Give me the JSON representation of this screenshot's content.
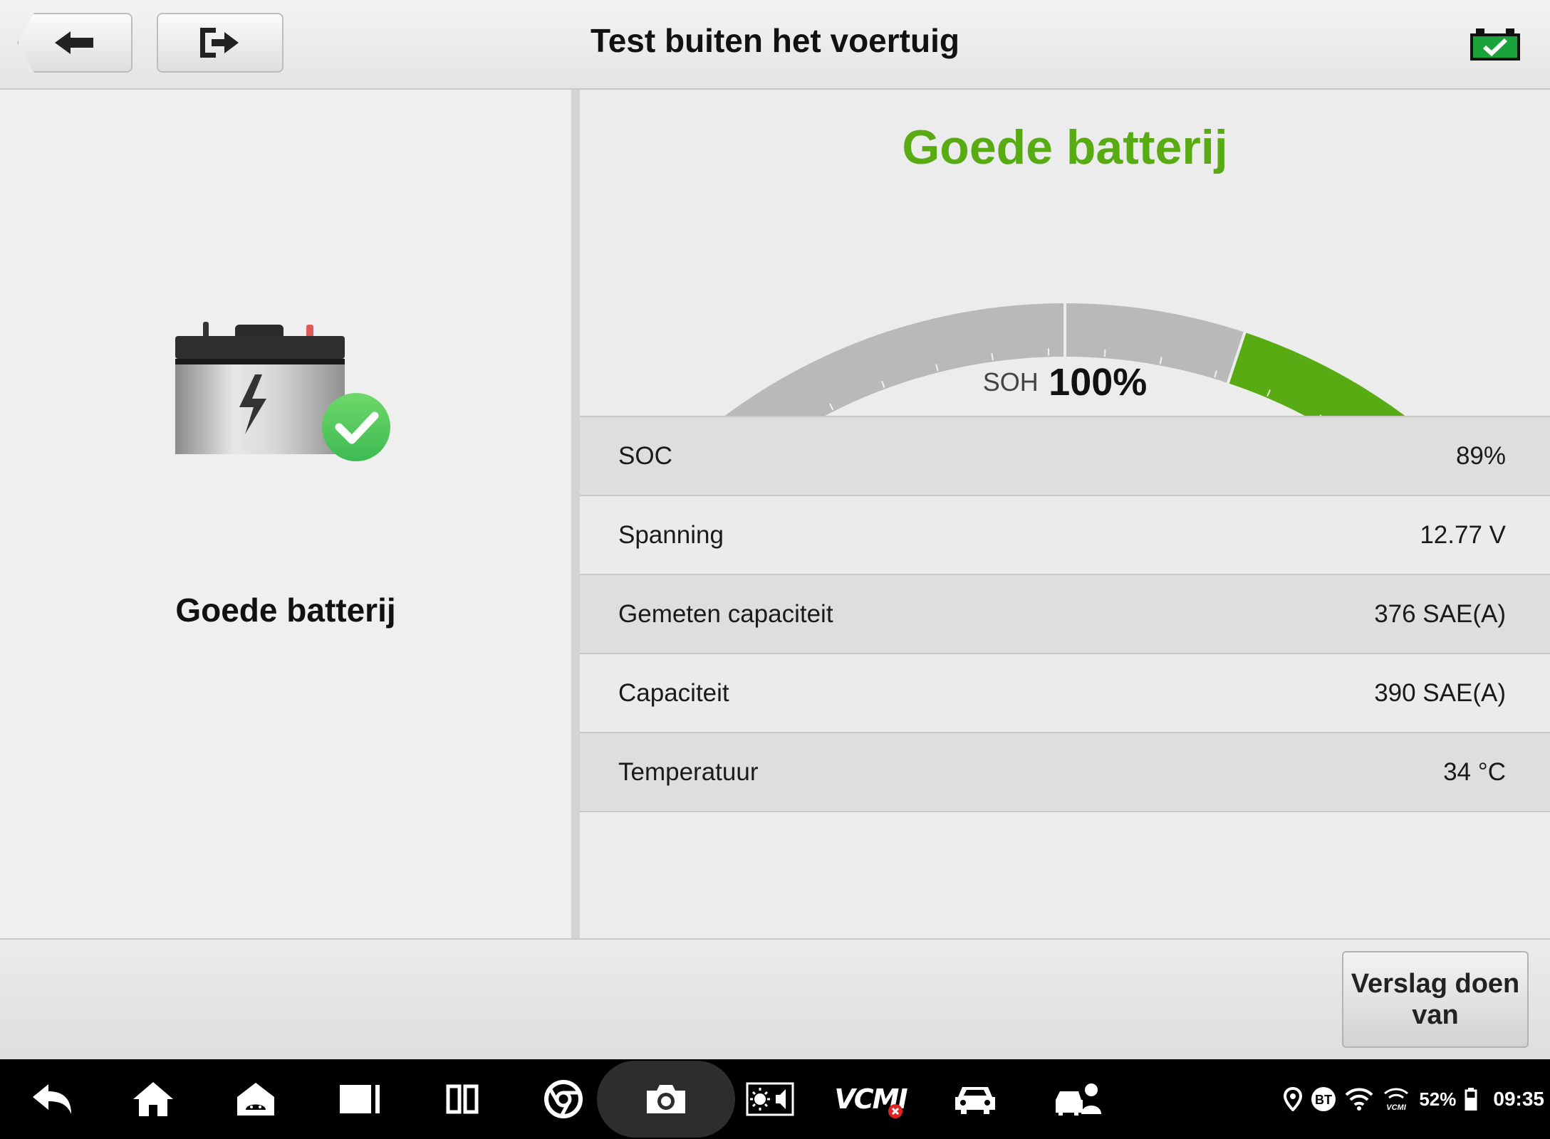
{
  "header": {
    "title": "Test buiten het voertuig",
    "back_icon": "back-arrow-icon",
    "exit_icon": "exit-icon",
    "status_icon": "battery-ok-icon"
  },
  "left_panel": {
    "icon": "battery-check-icon",
    "status_text": "Goede batterij"
  },
  "right_panel": {
    "result_title": "Goede batterij",
    "gauge": {
      "soh_label": "SOH",
      "soh_value": "100%",
      "soh_fraction": 1.0
    },
    "rows": [
      {
        "label": "SOC",
        "value": "89%"
      },
      {
        "label": "Spanning",
        "value": "12.77 V"
      },
      {
        "label": "Gemeten capaciteit",
        "value": "376 SAE(A)"
      },
      {
        "label": "Capaciteit",
        "value": "390 SAE(A)"
      },
      {
        "label": "Temperatuur",
        "value": "34 °C"
      }
    ]
  },
  "actions": {
    "report_label_line1": "Verslag doen",
    "report_label_line2": "van"
  },
  "navbar": {
    "icons": [
      "back-icon",
      "home-icon",
      "android-home-icon",
      "recent-apps-icon",
      "split-screen-icon",
      "chrome-icon",
      "camera-icon",
      "brightness-volume-icon",
      "vcmi-icon",
      "car-icon",
      "car-service-icon"
    ],
    "vcmi_label": "VCMI",
    "status": {
      "battery_percent": "52%",
      "time": "09:35",
      "bt_label": "BT",
      "vcmi_small": "VCMI"
    }
  },
  "colors": {
    "good": "#58ab12",
    "gauge_grey": "#b9b9b9"
  }
}
